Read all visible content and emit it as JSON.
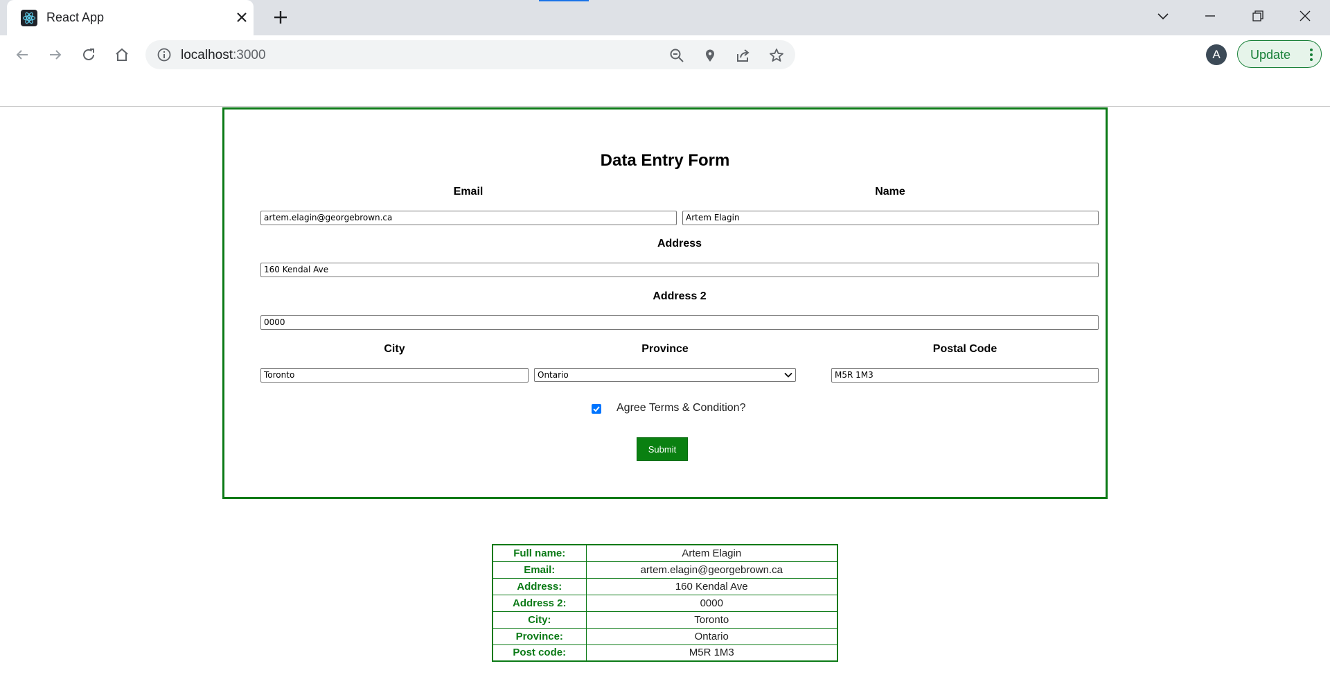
{
  "browser": {
    "tab_title": "React App",
    "url_host": "localhost",
    "url_port": ":3000",
    "avatar_letter": "A",
    "update_label": "Update"
  },
  "form": {
    "title": "Data Entry Form",
    "email": {
      "label": "Email",
      "value": "artem.elagin@georgebrown.ca"
    },
    "name": {
      "label": "Name",
      "value": "Artem Elagin"
    },
    "address": {
      "label": "Address",
      "value": "160 Kendal Ave"
    },
    "address2": {
      "label": "Address 2",
      "value": "0000"
    },
    "city": {
      "label": "City",
      "value": "Toronto"
    },
    "province": {
      "label": "Province",
      "value": "Ontario"
    },
    "postal": {
      "label": "Postal Code",
      "value": "M5R 1M3"
    },
    "agree_label": "Agree Terms & Condition?",
    "agree_checked": true,
    "submit_label": "Submit"
  },
  "result": {
    "rows": [
      {
        "key": "Full name:",
        "value": "Artem Elagin"
      },
      {
        "key": "Email:",
        "value": "artem.elagin@georgebrown.ca"
      },
      {
        "key": "Address:",
        "value": "160 Kendal Ave"
      },
      {
        "key": "Address 2:",
        "value": "0000"
      },
      {
        "key": "City:",
        "value": "Toronto"
      },
      {
        "key": "Province:",
        "value": "Ontario"
      },
      {
        "key": "Post code:",
        "value": "M5R 1M3"
      }
    ]
  },
  "colors": {
    "form_border": "#0b7a16",
    "submit_bg": "#0a8011",
    "checkbox": "#0075ff",
    "tabbar": "#dee1e6",
    "update_accent": "#188038"
  }
}
